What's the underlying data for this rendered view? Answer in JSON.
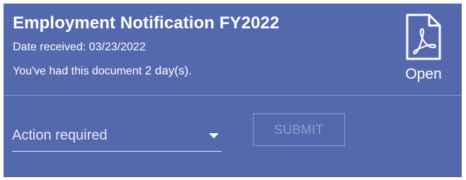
{
  "document": {
    "title": "Employment Notification FY2022",
    "date_received": "Date received: 03/23/2022",
    "held_prefix": "You've had this document",
    "held_days": "2 day(s)."
  },
  "open_button": {
    "label": "Open",
    "icon": "pdf-file-icon"
  },
  "action": {
    "placeholder": "Action required",
    "icon": "caret-down-icon"
  },
  "submit": {
    "label": "SUBMIT",
    "disabled": true
  },
  "colors": {
    "card_background": "#5468ae",
    "text": "#ffffff"
  }
}
